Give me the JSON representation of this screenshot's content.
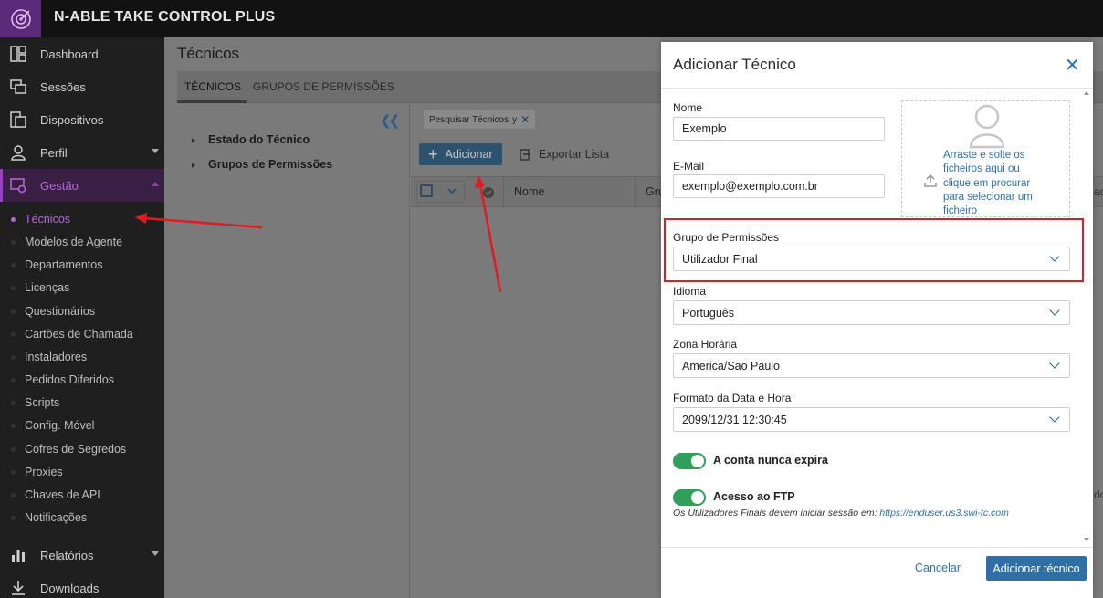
{
  "app": {
    "title": "N-ABLE TAKE CONTROL PLUS"
  },
  "sidebar": {
    "items": [
      {
        "label": "Dashboard",
        "icon": "dashboard-icon"
      },
      {
        "label": "Sessões",
        "icon": "sessions-icon"
      },
      {
        "label": "Dispositivos",
        "icon": "devices-icon"
      },
      {
        "label": "Perfil",
        "icon": "profile-icon"
      },
      {
        "label": "Gestão",
        "icon": "management-icon"
      },
      {
        "label": "Relatórios",
        "icon": "reports-icon"
      },
      {
        "label": "Downloads",
        "icon": "downloads-icon"
      }
    ],
    "sub_items": [
      "Técnicos",
      "Modelos de Agente",
      "Departamentos",
      "Licenças",
      "Questionários",
      "Cartões de Chamada",
      "Instaladores",
      "Pedidos Diferidos",
      "Scripts",
      "Config. Móvel",
      "Cofres de Segredos",
      "Proxies",
      "Chaves de API",
      "Notificações"
    ]
  },
  "main": {
    "page_title": "Técnicos",
    "tabs": [
      "TÉCNICOS",
      "GRUPOS DE PERMISSÕES"
    ],
    "tree": [
      "Estado do Técnico",
      "Grupos de Permissões"
    ],
    "filter_chip": "Pesquisar Técnicos",
    "filter_chip_value": "y",
    "add_button": "Adicionar",
    "export_button": "Exportar Lista",
    "columns": [
      "Nome",
      "Gru"
    ],
    "right_edge_header": "ado",
    "right_edge_text": "do"
  },
  "modal": {
    "title": "Adicionar Técnico",
    "name_label": "Nome",
    "name_value": "Exemplo",
    "email_label": "E-Mail",
    "email_value": "exemplo@exemplo.com.br",
    "dropzone_text": "Arraste e solte os ficheiros aqui ou clique em procurar para selecionar um ficheiro",
    "group_label": "Grupo de Permissões",
    "group_value": "Utilizador Final",
    "language_label": "Idioma",
    "language_value": "Português",
    "timezone_label": "Zona Horária",
    "timezone_value": "America/Sao Paulo",
    "datetime_label": "Formato da Data e Hora",
    "datetime_value": "2099/12/31 12:30:45",
    "never_expires_label": "A conta nunca expira",
    "never_expires_on": true,
    "ftp_label": "Acesso ao FTP",
    "ftp_on": true,
    "ftp_note": "Os Utilizadores Finais devem iniciar sessão em:",
    "ftp_link": "https://enduser.us3.swi-tc.com",
    "cancel": "Cancelar",
    "submit": "Adicionar técnico"
  },
  "colors": {
    "accent_purple": "#9b3fc7",
    "primary_blue": "#2e6fa8",
    "toggle_green": "#2fa05a",
    "annotation_red": "#e11b22"
  }
}
